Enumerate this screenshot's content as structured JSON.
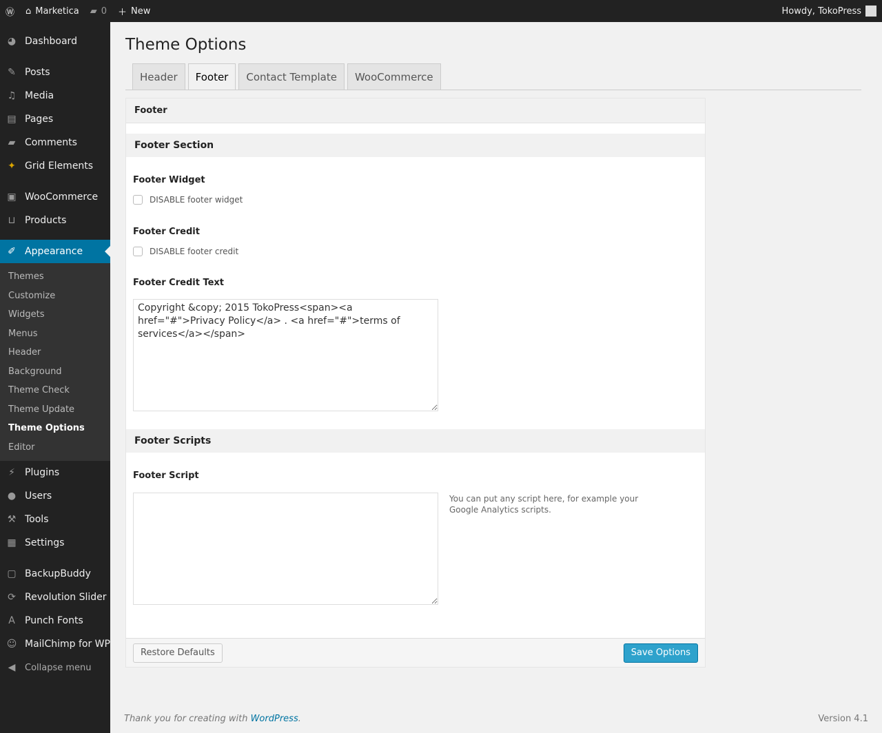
{
  "adminbar": {
    "site": "Marketica",
    "comments": "0",
    "new": "New",
    "howdy": "Howdy, TokoPress"
  },
  "sidebar": {
    "items": [
      "Dashboard",
      "Posts",
      "Media",
      "Pages",
      "Comments",
      "Grid Elements",
      "WooCommerce",
      "Products",
      "Appearance",
      "Plugins",
      "Users",
      "Tools",
      "Settings",
      "BackupBuddy",
      "Revolution Slider",
      "Punch Fonts",
      "MailChimp for WP",
      "Collapse menu"
    ],
    "submenu": [
      "Themes",
      "Customize",
      "Widgets",
      "Menus",
      "Header",
      "Background",
      "Theme Check",
      "Theme Update",
      "Theme Options",
      "Editor"
    ]
  },
  "page": {
    "title": "Theme Options",
    "tabs": [
      "Header",
      "Footer",
      "Contact Template",
      "WooCommerce"
    ],
    "active_tab": "Footer"
  },
  "panel": {
    "title": "Footer",
    "section1": "Footer Section",
    "footer_widget_label": "Footer Widget",
    "footer_widget_cb": "DISABLE footer widget",
    "footer_credit_label": "Footer Credit",
    "footer_credit_cb": "DISABLE footer credit",
    "credit_text_label": "Footer Credit Text",
    "credit_text_value": "Copyright &copy; 2015 TokoPress<span><a href=\"#\">Privacy Policy</a> . <a href=\"#\">terms of services</a></span>",
    "section2": "Footer Scripts",
    "script_label": "Footer Script",
    "script_value": "",
    "script_help": "You can put any script here, for example your Google Analytics scripts.",
    "restore": "Restore Defaults",
    "save": "Save Options"
  },
  "footer": {
    "thanks": "Thank you for creating with ",
    "wp": "WordPress",
    "period": ".",
    "version": "Version 4.1"
  },
  "colors": {
    "accent": "#0074a2",
    "button": "#2ea2cc"
  }
}
